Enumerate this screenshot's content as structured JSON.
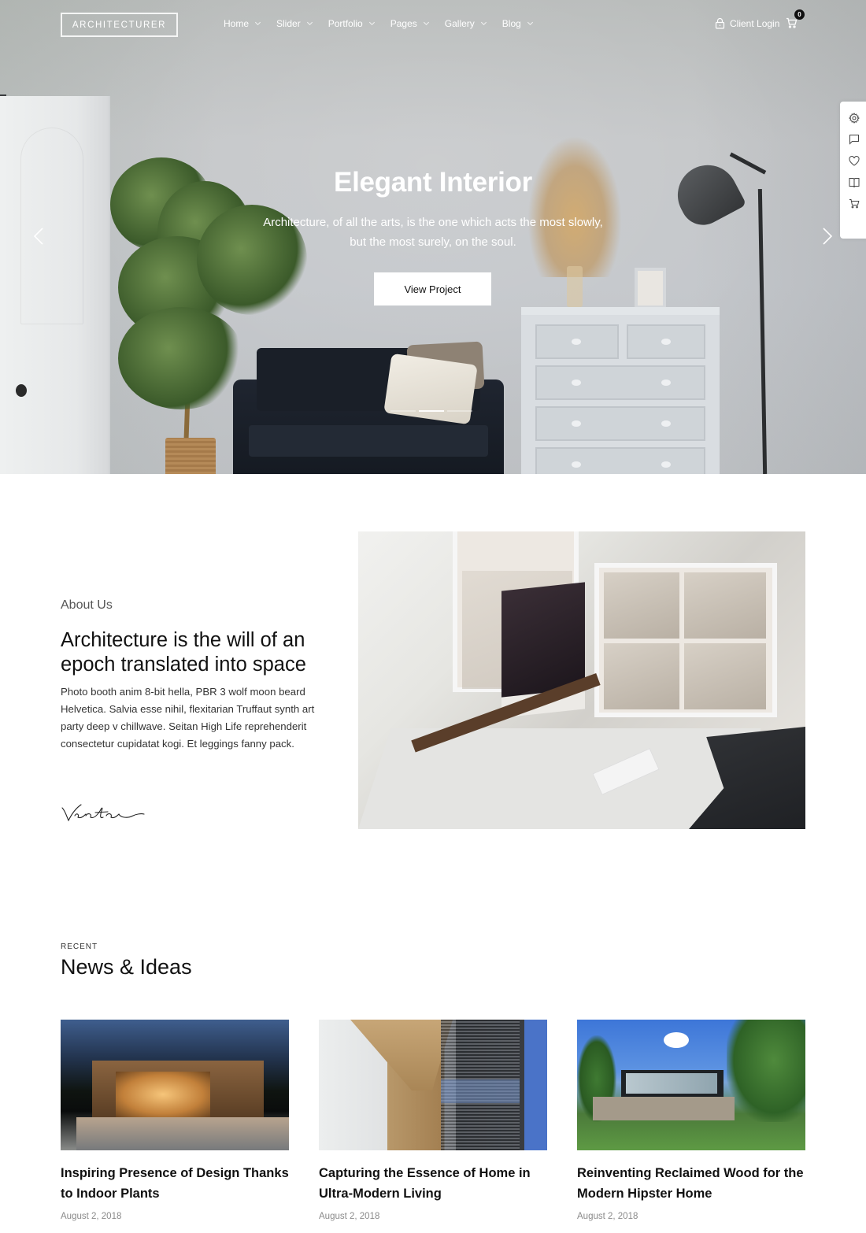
{
  "header": {
    "logo": "ARCHITECTURER",
    "nav": [
      {
        "label": "Home",
        "has_dropdown": true
      },
      {
        "label": "Slider",
        "has_dropdown": true
      },
      {
        "label": "Portfolio",
        "has_dropdown": true
      },
      {
        "label": "Pages",
        "has_dropdown": true
      },
      {
        "label": "Gallery",
        "has_dropdown": true
      },
      {
        "label": "Blog",
        "has_dropdown": true
      }
    ],
    "client_login": "Client Login",
    "cart_count": "0",
    "icons": {
      "login": "lock-icon",
      "cart": "cart-icon"
    }
  },
  "hero": {
    "title": "Elegant Interior",
    "subtitle": "Architecture, of all the arts, is the one which acts the most slowly, but the most surely, on the soul.",
    "button": "View Project",
    "prev_icon": "chevron-left-icon",
    "next_icon": "chevron-right-icon",
    "slides_total": 3,
    "active_slide": 2
  },
  "side_panel": {
    "icons": [
      "gear-icon",
      "comment-icon",
      "heart-icon",
      "book-icon",
      "cart-icon"
    ]
  },
  "about": {
    "label": "About Us",
    "title": "Architecture is the will of an epoch translated into space",
    "text": "Photo booth anim 8-bit hella, PBR 3 wolf moon beard Helvetica. Salvia esse nihil, flexitarian Truffaut synth art party deep v chillwave. Seitan High Life reprehenderit consectetur cupidatat kogi. Et leggings fanny pack.",
    "signature": "Victor"
  },
  "news": {
    "eyebrow": "RECENT",
    "title": "News & Ideas",
    "posts": [
      {
        "title": "Inspiring Presence of Design Thanks to Indoor Plants",
        "date": "August 2, 2018"
      },
      {
        "title": "Capturing the Essence of Home in Ultra-Modern Living",
        "date": "August 2, 2018"
      },
      {
        "title": "Reinventing Reclaimed Wood for the Modern Hipster Home",
        "date": "August 2, 2018"
      }
    ]
  },
  "colors": {
    "text_primary": "#111111",
    "text_body": "#333333",
    "text_muted": "#8a8a8a",
    "hero_text": "#ffffff",
    "badge_bg": "#111111"
  }
}
